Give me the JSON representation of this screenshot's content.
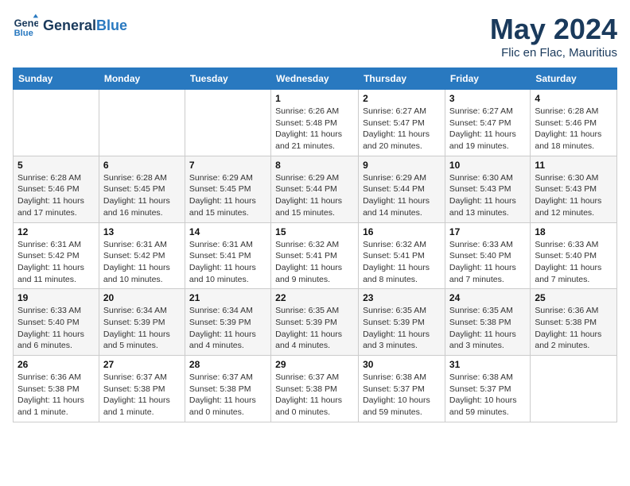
{
  "header": {
    "logo_line1": "General",
    "logo_line2": "Blue",
    "title": "May 2024",
    "subtitle": "Flic en Flac, Mauritius"
  },
  "weekdays": [
    "Sunday",
    "Monday",
    "Tuesday",
    "Wednesday",
    "Thursday",
    "Friday",
    "Saturday"
  ],
  "weeks": [
    [
      {
        "day": "",
        "info": ""
      },
      {
        "day": "",
        "info": ""
      },
      {
        "day": "",
        "info": ""
      },
      {
        "day": "1",
        "info": "Sunrise: 6:26 AM\nSunset: 5:48 PM\nDaylight: 11 hours and 21 minutes."
      },
      {
        "day": "2",
        "info": "Sunrise: 6:27 AM\nSunset: 5:47 PM\nDaylight: 11 hours and 20 minutes."
      },
      {
        "day": "3",
        "info": "Sunrise: 6:27 AM\nSunset: 5:47 PM\nDaylight: 11 hours and 19 minutes."
      },
      {
        "day": "4",
        "info": "Sunrise: 6:28 AM\nSunset: 5:46 PM\nDaylight: 11 hours and 18 minutes."
      }
    ],
    [
      {
        "day": "5",
        "info": "Sunrise: 6:28 AM\nSunset: 5:46 PM\nDaylight: 11 hours and 17 minutes."
      },
      {
        "day": "6",
        "info": "Sunrise: 6:28 AM\nSunset: 5:45 PM\nDaylight: 11 hours and 16 minutes."
      },
      {
        "day": "7",
        "info": "Sunrise: 6:29 AM\nSunset: 5:45 PM\nDaylight: 11 hours and 15 minutes."
      },
      {
        "day": "8",
        "info": "Sunrise: 6:29 AM\nSunset: 5:44 PM\nDaylight: 11 hours and 15 minutes."
      },
      {
        "day": "9",
        "info": "Sunrise: 6:29 AM\nSunset: 5:44 PM\nDaylight: 11 hours and 14 minutes."
      },
      {
        "day": "10",
        "info": "Sunrise: 6:30 AM\nSunset: 5:43 PM\nDaylight: 11 hours and 13 minutes."
      },
      {
        "day": "11",
        "info": "Sunrise: 6:30 AM\nSunset: 5:43 PM\nDaylight: 11 hours and 12 minutes."
      }
    ],
    [
      {
        "day": "12",
        "info": "Sunrise: 6:31 AM\nSunset: 5:42 PM\nDaylight: 11 hours and 11 minutes."
      },
      {
        "day": "13",
        "info": "Sunrise: 6:31 AM\nSunset: 5:42 PM\nDaylight: 11 hours and 10 minutes."
      },
      {
        "day": "14",
        "info": "Sunrise: 6:31 AM\nSunset: 5:41 PM\nDaylight: 11 hours and 10 minutes."
      },
      {
        "day": "15",
        "info": "Sunrise: 6:32 AM\nSunset: 5:41 PM\nDaylight: 11 hours and 9 minutes."
      },
      {
        "day": "16",
        "info": "Sunrise: 6:32 AM\nSunset: 5:41 PM\nDaylight: 11 hours and 8 minutes."
      },
      {
        "day": "17",
        "info": "Sunrise: 6:33 AM\nSunset: 5:40 PM\nDaylight: 11 hours and 7 minutes."
      },
      {
        "day": "18",
        "info": "Sunrise: 6:33 AM\nSunset: 5:40 PM\nDaylight: 11 hours and 7 minutes."
      }
    ],
    [
      {
        "day": "19",
        "info": "Sunrise: 6:33 AM\nSunset: 5:40 PM\nDaylight: 11 hours and 6 minutes."
      },
      {
        "day": "20",
        "info": "Sunrise: 6:34 AM\nSunset: 5:39 PM\nDaylight: 11 hours and 5 minutes."
      },
      {
        "day": "21",
        "info": "Sunrise: 6:34 AM\nSunset: 5:39 PM\nDaylight: 11 hours and 4 minutes."
      },
      {
        "day": "22",
        "info": "Sunrise: 6:35 AM\nSunset: 5:39 PM\nDaylight: 11 hours and 4 minutes."
      },
      {
        "day": "23",
        "info": "Sunrise: 6:35 AM\nSunset: 5:39 PM\nDaylight: 11 hours and 3 minutes."
      },
      {
        "day": "24",
        "info": "Sunrise: 6:35 AM\nSunset: 5:38 PM\nDaylight: 11 hours and 3 minutes."
      },
      {
        "day": "25",
        "info": "Sunrise: 6:36 AM\nSunset: 5:38 PM\nDaylight: 11 hours and 2 minutes."
      }
    ],
    [
      {
        "day": "26",
        "info": "Sunrise: 6:36 AM\nSunset: 5:38 PM\nDaylight: 11 hours and 1 minute."
      },
      {
        "day": "27",
        "info": "Sunrise: 6:37 AM\nSunset: 5:38 PM\nDaylight: 11 hours and 1 minute."
      },
      {
        "day": "28",
        "info": "Sunrise: 6:37 AM\nSunset: 5:38 PM\nDaylight: 11 hours and 0 minutes."
      },
      {
        "day": "29",
        "info": "Sunrise: 6:37 AM\nSunset: 5:38 PM\nDaylight: 11 hours and 0 minutes."
      },
      {
        "day": "30",
        "info": "Sunrise: 6:38 AM\nSunset: 5:37 PM\nDaylight: 10 hours and 59 minutes."
      },
      {
        "day": "31",
        "info": "Sunrise: 6:38 AM\nSunset: 5:37 PM\nDaylight: 10 hours and 59 minutes."
      },
      {
        "day": "",
        "info": ""
      }
    ]
  ]
}
